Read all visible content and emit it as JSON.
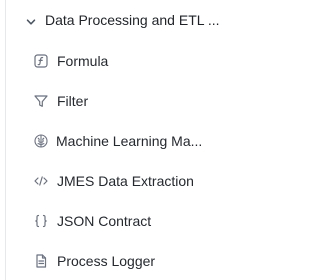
{
  "group": {
    "title": "Data Processing and ETL ...",
    "icon": "chevron-down-icon"
  },
  "items": [
    {
      "label": "Formula",
      "icon": "formula-icon"
    },
    {
      "label": "Filter",
      "icon": "filter-icon"
    },
    {
      "label": "Machine Learning Ma...",
      "icon": "brain-icon"
    },
    {
      "label": "JMES Data Extraction",
      "icon": "code-icon"
    },
    {
      "label": "JSON Contract",
      "icon": "braces-icon"
    },
    {
      "label": "Process Logger",
      "icon": "document-icon"
    }
  ],
  "colors": {
    "text": "#24292f",
    "icon": "#6b7280",
    "divider": "#e6e8eb"
  }
}
